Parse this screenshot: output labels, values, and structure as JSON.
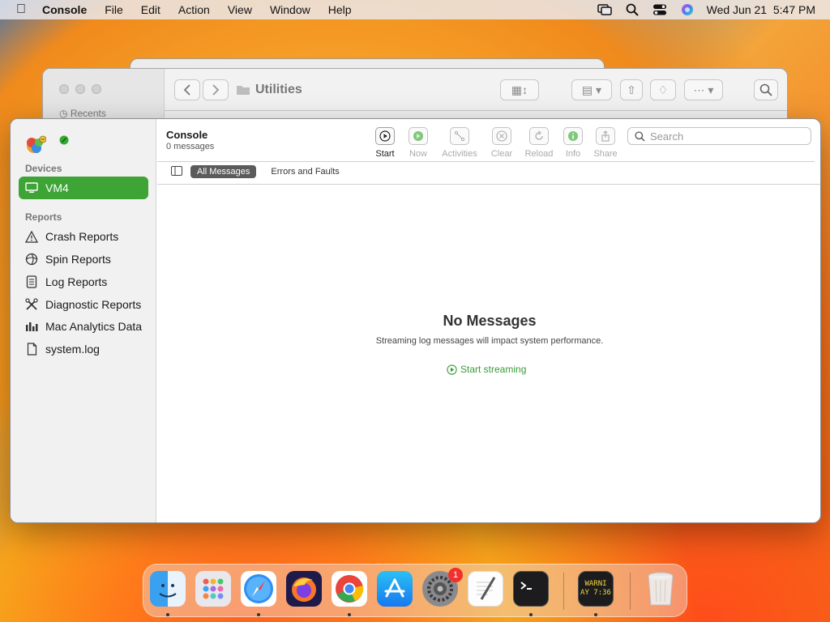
{
  "menubar": {
    "app_name": "Console",
    "items": [
      "File",
      "Edit",
      "Action",
      "View",
      "Window",
      "Help"
    ],
    "clock": "Wed Jun 21  5:47 PM"
  },
  "finder": {
    "title": "Utilities",
    "sidebar_item": "Recents"
  },
  "console": {
    "title": "Console",
    "subtitle": "0 messages",
    "sidebar": {
      "devices_header": "Devices",
      "device": "VM4",
      "reports_header": "Reports",
      "reports": [
        {
          "label": "Crash Reports",
          "icon": "warning-icon"
        },
        {
          "label": "Spin Reports",
          "icon": "spin-icon"
        },
        {
          "label": "Log Reports",
          "icon": "log-icon"
        },
        {
          "label": "Diagnostic Reports",
          "icon": "tools-icon"
        },
        {
          "label": "Mac Analytics Data",
          "icon": "bar-chart-icon"
        },
        {
          "label": "system.log",
          "icon": "document-icon"
        }
      ]
    },
    "toolbar": {
      "start": "Start",
      "now": "Now",
      "activities": "Activities",
      "clear": "Clear",
      "reload": "Reload",
      "info": "Info",
      "share": "Share",
      "search_placeholder": "Search"
    },
    "filters": {
      "all": "All Messages",
      "errors": "Errors and Faults"
    },
    "empty": {
      "title": "No Messages",
      "subtitle": "Streaming log messages will impact system performance.",
      "action": "Start streaming"
    }
  },
  "dock": {
    "settings_badge": "1",
    "console_line1": "WARNI",
    "console_line2": "AY 7:36"
  },
  "colors": {
    "accent_green": "#3ea436",
    "selected_filter": "#5b5b5b"
  }
}
